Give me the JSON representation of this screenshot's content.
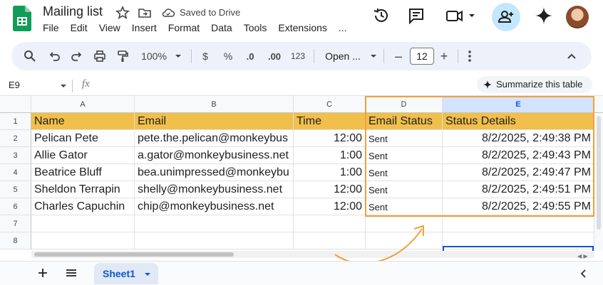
{
  "header": {
    "title": "Mailing list",
    "saved_status": "Saved to Drive",
    "menu": [
      "File",
      "Edit",
      "View",
      "Insert",
      "Format",
      "Data",
      "Tools",
      "Extensions",
      "..."
    ]
  },
  "toolbar": {
    "zoom": "100%",
    "currency": "$",
    "percent": "%",
    "decrease_decimal": ".0",
    "increase_decimal": ".00",
    "number_format": "123",
    "font": "Open ...",
    "font_size": "12",
    "minus": "–",
    "plus": "+"
  },
  "formula_bar": {
    "cell_ref": "E9",
    "fx": "fx",
    "summarize_label": "Summarize this table"
  },
  "grid": {
    "columns": [
      "A",
      "B",
      "C",
      "D",
      "E"
    ],
    "selected_column": "E",
    "row_numbers": [
      "1",
      "2",
      "3",
      "4",
      "5",
      "6",
      "7",
      "8"
    ],
    "header_row": [
      "Name",
      "Email",
      "Time",
      "Email Status",
      "Status Details"
    ],
    "rows": [
      [
        "Pelican Pete",
        "pete.the.pelican@monkeybus",
        "12:00",
        "Sent",
        "8/2/2025, 2:49:38 PM"
      ],
      [
        "Allie Gator",
        "a.gator@monkeybusiness.net",
        "1:00",
        "Sent",
        "8/2/2025, 2:49:43 PM"
      ],
      [
        "Beatrice Bluff",
        "bea.unimpressed@monkeybu",
        "1:00",
        "Sent",
        "8/2/2025, 2:49:47 PM"
      ],
      [
        "Sheldon Terrapin",
        "shelly@monkeybusiness.net",
        "12:00",
        "Sent",
        "8/2/2025, 2:49:51 PM"
      ],
      [
        "Charles Capuchin",
        "chip@monkeybusiness.net",
        "12:00",
        "Sent",
        "8/2/2025, 2:49:55 PM"
      ]
    ]
  },
  "sheets": {
    "active": "Sheet1"
  },
  "colors": {
    "header_fill": "#f0bf4c",
    "highlight_outline": "#f2a03d",
    "accent": "#0b57d0"
  }
}
